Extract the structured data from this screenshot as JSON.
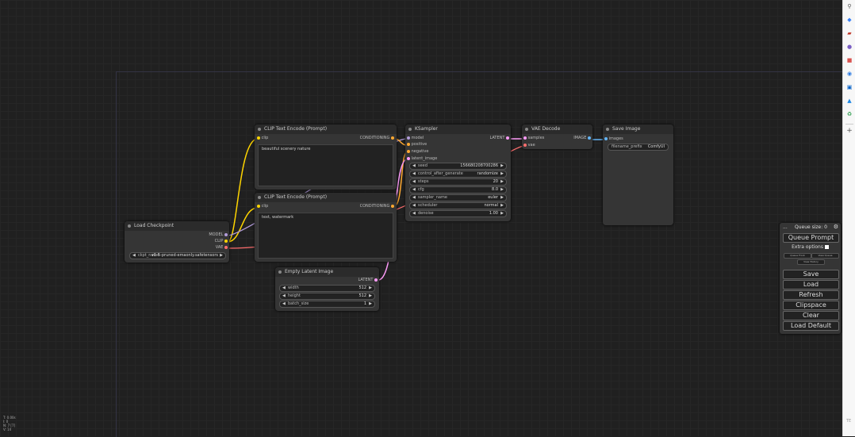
{
  "nodes": {
    "clip_pos": {
      "title": "CLIP Text Encode (Prompt)",
      "in_clip": "clip",
      "out": "CONDITIONING",
      "text": "beautiful scenery nature"
    },
    "clip_neg": {
      "title": "CLIP Text Encode (Prompt)",
      "in_clip": "clip",
      "out": "CONDITIONING",
      "text": "text, watermark"
    },
    "ksampler": {
      "title": "KSampler",
      "inputs": [
        "model",
        "positive",
        "negative",
        "latent_image"
      ],
      "out": "LATENT",
      "widgets": [
        {
          "label": "seed",
          "value": "156680208700286"
        },
        {
          "label": "control_after_generate",
          "value": "randomize"
        },
        {
          "label": "steps",
          "value": "20"
        },
        {
          "label": "cfg",
          "value": "8.0"
        },
        {
          "label": "sampler_name",
          "value": "euler"
        },
        {
          "label": "scheduler",
          "value": "normal"
        },
        {
          "label": "denoise",
          "value": "1.00"
        }
      ]
    },
    "vae_decode": {
      "title": "VAE Decode",
      "inputs": [
        "samples",
        "vae"
      ],
      "out": "IMAGE"
    },
    "save_image": {
      "title": "Save Image",
      "in_images": "images",
      "widget_label": "filename_prefix",
      "widget_value": "ComfyUI"
    },
    "load_ckpt": {
      "title": "Load Checkpoint",
      "outs": [
        "MODEL",
        "CLIP",
        "VAE"
      ],
      "widget_label": "ckpt_name",
      "widget_value": "v1-5-pruned-emaonly.safetensors"
    },
    "empty_latent": {
      "title": "Empty Latent Image",
      "out": "LATENT",
      "widgets": [
        {
          "label": "width",
          "value": "512"
        },
        {
          "label": "height",
          "value": "512"
        },
        {
          "label": "batch_size",
          "value": "1"
        }
      ]
    }
  },
  "queue_panel": {
    "queue_size": "Queue size: 0",
    "queue_prompt": "Queue Prompt",
    "extra_options": "Extra options",
    "queue_front": "Queue Front",
    "view_queue": "View Queue",
    "view_history": "View History",
    "save": "Save",
    "load": "Load",
    "refresh": "Refresh",
    "clipspace": "Clipspace",
    "clear": "Clear",
    "load_default": "Load Default"
  },
  "stats": [
    "T: 0.00s",
    "I: 0",
    "N: 7 [7]",
    "V: 14"
  ],
  "corner_label": "TE",
  "colors": {
    "model": "#b39ddb",
    "clip": "#ffd500",
    "vae": "#ff6e6e",
    "conditioning": "#ffa931",
    "latent": "#ff9cf9",
    "image": "#64b5f6"
  },
  "sidebar_icons": [
    "search-icon",
    "tag-icon",
    "briefcase-icon",
    "user-icon",
    "office-icon",
    "edge-icon",
    "outlook-icon",
    "chart-icon",
    "recycle-icon",
    "plus-icon"
  ]
}
